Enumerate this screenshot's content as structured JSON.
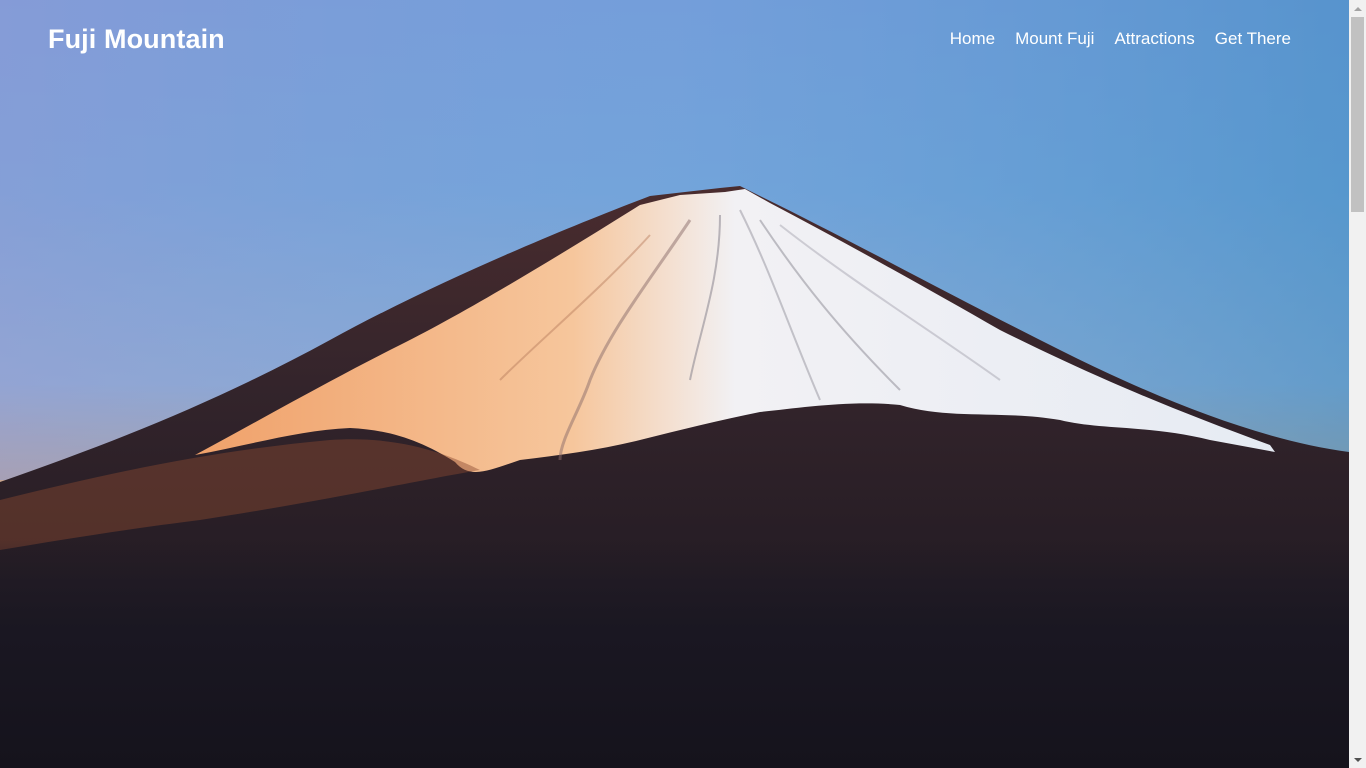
{
  "header": {
    "logo": "Fuji Mountain",
    "nav": [
      {
        "label": "Home"
      },
      {
        "label": "Mount Fuji"
      },
      {
        "label": "Attractions"
      },
      {
        "label": "Get There"
      }
    ]
  },
  "hero": {
    "image": "mount-fuji-sunrise-photo",
    "colors": {
      "sky_top": "#5fa3da",
      "sky_horizon": "#c9a690",
      "snow": "#f2f4f8",
      "alpenglow": "#f2a66a",
      "mountain_base": "#3a2a35",
      "ground": "#15131c"
    }
  },
  "scrollbar": {
    "position_fraction": 0.0
  }
}
